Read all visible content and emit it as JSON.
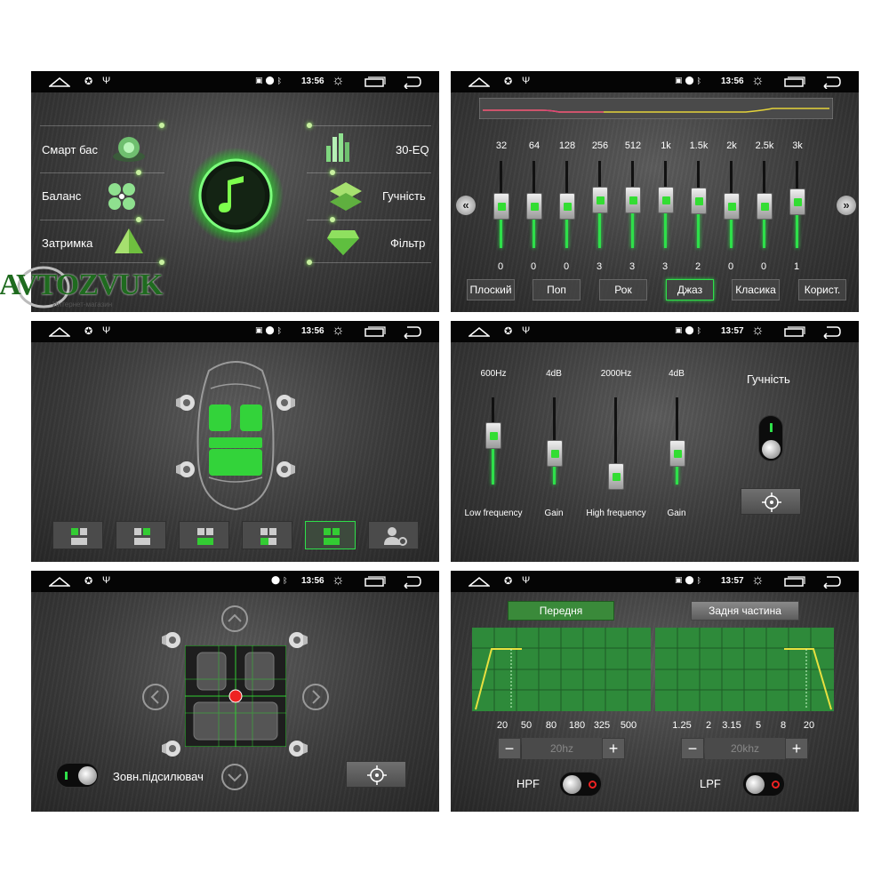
{
  "statusbar": {
    "p1_time": "13:56",
    "p2_time": "13:56",
    "p3_time": "13:56",
    "p4_time": "13:57",
    "p5_time": "13:56",
    "p6_time": "13:57"
  },
  "watermark": {
    "brand": "AVTOZVUK",
    "tagline": "Интернет-магазин"
  },
  "panel1": {
    "left": [
      "Смарт бас",
      "Баланс",
      "Затримка"
    ],
    "right": [
      "30-EQ",
      "Гучність",
      "Фільтр"
    ]
  },
  "panel2": {
    "freqs": [
      "32",
      "64",
      "128",
      "256",
      "512",
      "1k",
      "1.5k",
      "2k",
      "2.5k",
      "3k"
    ],
    "values": [
      0,
      0,
      0,
      3,
      3,
      3,
      2,
      0,
      0,
      1
    ],
    "presets": [
      "Плоский",
      "Поп",
      "Рок",
      "Джаз",
      "Класика",
      "Корист."
    ],
    "selected_preset": "Джаз"
  },
  "panel3": {
    "selected_seat_mode": 5
  },
  "panel4": {
    "labels_top": [
      "600Hz",
      "4dB",
      "2000Hz",
      "4dB"
    ],
    "labels_bottom": [
      "Low frequency",
      "Gain",
      "High frequency",
      "Gain"
    ],
    "volume_title": "Гучність"
  },
  "panel5": {
    "subwoofer_label": "Зовн.підсилювач"
  },
  "panel6": {
    "tab_front": "Передня",
    "tab_rear": "Задня частина",
    "front_ticks": [
      "20",
      "50",
      "80",
      "180",
      "325",
      "500"
    ],
    "rear_ticks": [
      "1.25",
      "2",
      "3.15",
      "5",
      "8",
      "20"
    ],
    "hpf_value": "20hz",
    "lpf_value": "20khz",
    "hpf_label": "HPF",
    "lpf_label": "LPF",
    "minus": "−",
    "plus": "+"
  },
  "colors": {
    "accent": "#2ee04a"
  }
}
